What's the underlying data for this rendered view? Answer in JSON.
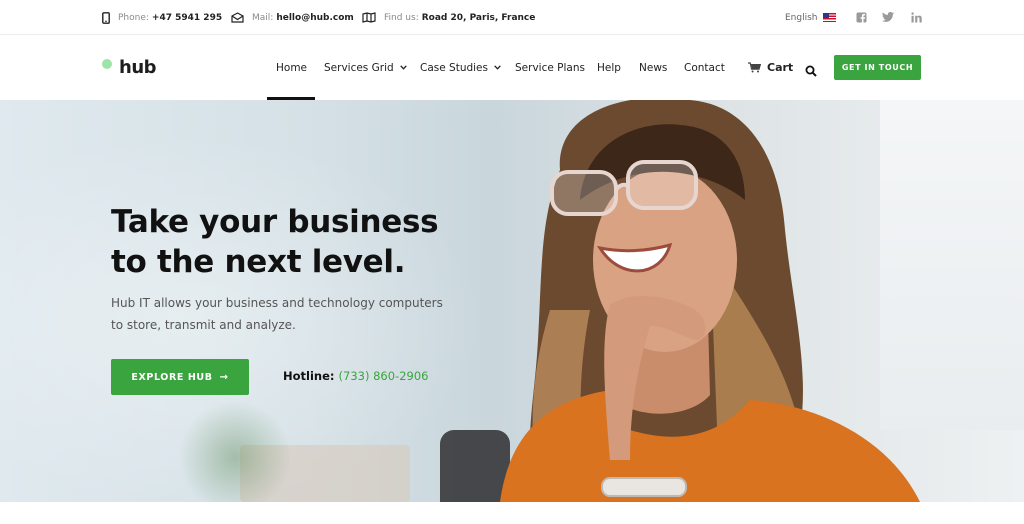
{
  "topbar": {
    "phone": {
      "label": "Phone:",
      "value": "+47 5941 295",
      "icon": "phone-icon"
    },
    "mail": {
      "label": "Mail:",
      "value": "hello@hub.com",
      "icon": "envelope-icon"
    },
    "address": {
      "label": "Find us:",
      "value": "Road 20, Paris, France",
      "icon": "map-icon"
    },
    "language": {
      "label": "English",
      "icon": "us-flag-icon"
    },
    "social": [
      "facebook-icon",
      "twitter-icon",
      "linkedin-icon"
    ]
  },
  "nav": {
    "logo": "hub",
    "items": [
      {
        "label": "Home",
        "active": true
      },
      {
        "label": "Services Grid",
        "dropdown": true
      },
      {
        "label": "Case Studies",
        "dropdown": true
      },
      {
        "label": "Service Plans"
      },
      {
        "label": "Help"
      },
      {
        "label": "News"
      },
      {
        "label": "Contact"
      }
    ],
    "cart_label": "Cart",
    "cta_label": "GET IN TOUCH"
  },
  "hero": {
    "headline_line1": "Take your business",
    "headline_line2": "to the next level.",
    "sub_line1": "Hub IT allows your business and technology computers",
    "sub_line2": "to store, transmit and analyze.",
    "cta_label": "EXPLORE HUB",
    "hotline_label": "Hotline:",
    "hotline_number": "(733) 860-2906"
  },
  "colors": {
    "accent": "#3aa43f",
    "text": "#111111"
  }
}
